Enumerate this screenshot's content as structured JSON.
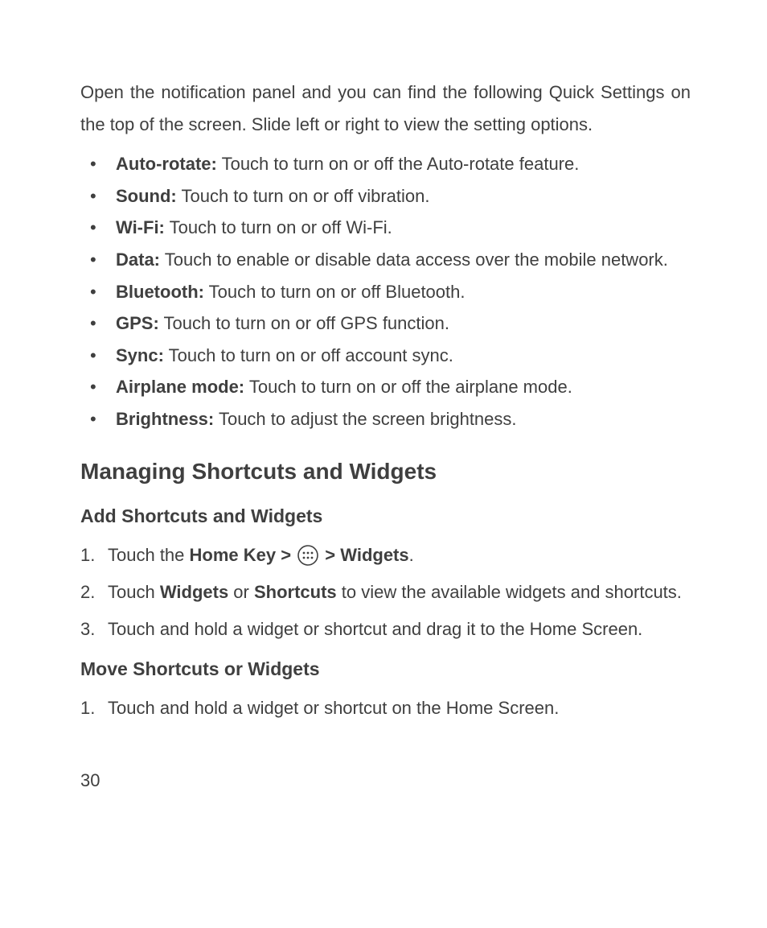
{
  "intro": "Open the notification panel and you can find the following Quick Settings on the top of the screen. Slide left or right to view the setting options.",
  "bullets": [
    {
      "label": "Auto-rotate:",
      "desc": " Touch to turn on or off the Auto-rotate feature."
    },
    {
      "label": "Sound:",
      "desc": " Touch to turn on or off vibration."
    },
    {
      "label": "Wi-Fi:",
      "desc": " Touch to turn on or off Wi-Fi."
    },
    {
      "label": "Data:",
      "desc": " Touch to enable or disable data access over the mobile network."
    },
    {
      "label": "Bluetooth:",
      "desc": " Touch to turn on or off Bluetooth."
    },
    {
      "label": "GPS:",
      "desc": " Touch to turn on or off GPS function."
    },
    {
      "label": "Sync:",
      "desc": " Touch to turn on or off account sync."
    },
    {
      "label": "Airplane mode:",
      "desc": " Touch to turn on or off the airplane mode."
    },
    {
      "label": "Brightness:",
      "desc": " Touch to adjust the screen brightness."
    }
  ],
  "heading_main": "Managing Shortcuts and Widgets",
  "heading_add": "Add Shortcuts and Widgets",
  "add_steps": {
    "s1_pre": "Touch the ",
    "s1_bold1": "Home Key > ",
    "s1_bold2": " > Widgets",
    "s1_post": ".",
    "s2_a": "Touch ",
    "s2_b": "Widgets",
    "s2_c": " or ",
    "s2_d": "Shortcuts",
    "s2_e": " to view the available widgets and shortcuts.",
    "s3": "Touch and hold a widget or shortcut and drag it to the Home Screen."
  },
  "heading_move": "Move Shortcuts or Widgets",
  "move_steps": {
    "s1": "Touch and hold a widget or shortcut on the Home Screen."
  },
  "page_number": "30"
}
